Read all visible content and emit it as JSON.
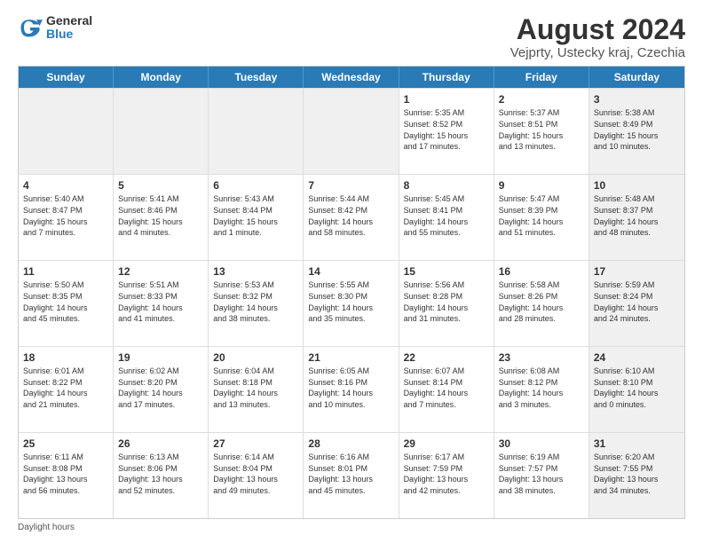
{
  "logo": {
    "line1": "General",
    "line2": "Blue"
  },
  "title": "August 2024",
  "subtitle": "Vejprty, Ustecky kraj, Czechia",
  "days_of_week": [
    "Sunday",
    "Monday",
    "Tuesday",
    "Wednesday",
    "Thursday",
    "Friday",
    "Saturday"
  ],
  "footer": "Daylight hours",
  "weeks": [
    [
      {
        "day": "",
        "info": "",
        "shaded": true
      },
      {
        "day": "",
        "info": "",
        "shaded": true
      },
      {
        "day": "",
        "info": "",
        "shaded": true
      },
      {
        "day": "",
        "info": "",
        "shaded": true
      },
      {
        "day": "1",
        "info": "Sunrise: 5:35 AM\nSunset: 8:52 PM\nDaylight: 15 hours\nand 17 minutes.",
        "shaded": false
      },
      {
        "day": "2",
        "info": "Sunrise: 5:37 AM\nSunset: 8:51 PM\nDaylight: 15 hours\nand 13 minutes.",
        "shaded": false
      },
      {
        "day": "3",
        "info": "Sunrise: 5:38 AM\nSunset: 8:49 PM\nDaylight: 15 hours\nand 10 minutes.",
        "shaded": true
      }
    ],
    [
      {
        "day": "4",
        "info": "Sunrise: 5:40 AM\nSunset: 8:47 PM\nDaylight: 15 hours\nand 7 minutes.",
        "shaded": false
      },
      {
        "day": "5",
        "info": "Sunrise: 5:41 AM\nSunset: 8:46 PM\nDaylight: 15 hours\nand 4 minutes.",
        "shaded": false
      },
      {
        "day": "6",
        "info": "Sunrise: 5:43 AM\nSunset: 8:44 PM\nDaylight: 15 hours\nand 1 minute.",
        "shaded": false
      },
      {
        "day": "7",
        "info": "Sunrise: 5:44 AM\nSunset: 8:42 PM\nDaylight: 14 hours\nand 58 minutes.",
        "shaded": false
      },
      {
        "day": "8",
        "info": "Sunrise: 5:45 AM\nSunset: 8:41 PM\nDaylight: 14 hours\nand 55 minutes.",
        "shaded": false
      },
      {
        "day": "9",
        "info": "Sunrise: 5:47 AM\nSunset: 8:39 PM\nDaylight: 14 hours\nand 51 minutes.",
        "shaded": false
      },
      {
        "day": "10",
        "info": "Sunrise: 5:48 AM\nSunset: 8:37 PM\nDaylight: 14 hours\nand 48 minutes.",
        "shaded": true
      }
    ],
    [
      {
        "day": "11",
        "info": "Sunrise: 5:50 AM\nSunset: 8:35 PM\nDaylight: 14 hours\nand 45 minutes.",
        "shaded": false
      },
      {
        "day": "12",
        "info": "Sunrise: 5:51 AM\nSunset: 8:33 PM\nDaylight: 14 hours\nand 41 minutes.",
        "shaded": false
      },
      {
        "day": "13",
        "info": "Sunrise: 5:53 AM\nSunset: 8:32 PM\nDaylight: 14 hours\nand 38 minutes.",
        "shaded": false
      },
      {
        "day": "14",
        "info": "Sunrise: 5:55 AM\nSunset: 8:30 PM\nDaylight: 14 hours\nand 35 minutes.",
        "shaded": false
      },
      {
        "day": "15",
        "info": "Sunrise: 5:56 AM\nSunset: 8:28 PM\nDaylight: 14 hours\nand 31 minutes.",
        "shaded": false
      },
      {
        "day": "16",
        "info": "Sunrise: 5:58 AM\nSunset: 8:26 PM\nDaylight: 14 hours\nand 28 minutes.",
        "shaded": false
      },
      {
        "day": "17",
        "info": "Sunrise: 5:59 AM\nSunset: 8:24 PM\nDaylight: 14 hours\nand 24 minutes.",
        "shaded": true
      }
    ],
    [
      {
        "day": "18",
        "info": "Sunrise: 6:01 AM\nSunset: 8:22 PM\nDaylight: 14 hours\nand 21 minutes.",
        "shaded": false
      },
      {
        "day": "19",
        "info": "Sunrise: 6:02 AM\nSunset: 8:20 PM\nDaylight: 14 hours\nand 17 minutes.",
        "shaded": false
      },
      {
        "day": "20",
        "info": "Sunrise: 6:04 AM\nSunset: 8:18 PM\nDaylight: 14 hours\nand 13 minutes.",
        "shaded": false
      },
      {
        "day": "21",
        "info": "Sunrise: 6:05 AM\nSunset: 8:16 PM\nDaylight: 14 hours\nand 10 minutes.",
        "shaded": false
      },
      {
        "day": "22",
        "info": "Sunrise: 6:07 AM\nSunset: 8:14 PM\nDaylight: 14 hours\nand 7 minutes.",
        "shaded": false
      },
      {
        "day": "23",
        "info": "Sunrise: 6:08 AM\nSunset: 8:12 PM\nDaylight: 14 hours\nand 3 minutes.",
        "shaded": false
      },
      {
        "day": "24",
        "info": "Sunrise: 6:10 AM\nSunset: 8:10 PM\nDaylight: 14 hours\nand 0 minutes.",
        "shaded": true
      }
    ],
    [
      {
        "day": "25",
        "info": "Sunrise: 6:11 AM\nSunset: 8:08 PM\nDaylight: 13 hours\nand 56 minutes.",
        "shaded": false
      },
      {
        "day": "26",
        "info": "Sunrise: 6:13 AM\nSunset: 8:06 PM\nDaylight: 13 hours\nand 52 minutes.",
        "shaded": false
      },
      {
        "day": "27",
        "info": "Sunrise: 6:14 AM\nSunset: 8:04 PM\nDaylight: 13 hours\nand 49 minutes.",
        "shaded": false
      },
      {
        "day": "28",
        "info": "Sunrise: 6:16 AM\nSunset: 8:01 PM\nDaylight: 13 hours\nand 45 minutes.",
        "shaded": false
      },
      {
        "day": "29",
        "info": "Sunrise: 6:17 AM\nSunset: 7:59 PM\nDaylight: 13 hours\nand 42 minutes.",
        "shaded": false
      },
      {
        "day": "30",
        "info": "Sunrise: 6:19 AM\nSunset: 7:57 PM\nDaylight: 13 hours\nand 38 minutes.",
        "shaded": false
      },
      {
        "day": "31",
        "info": "Sunrise: 6:20 AM\nSunset: 7:55 PM\nDaylight: 13 hours\nand 34 minutes.",
        "shaded": true
      }
    ]
  ]
}
